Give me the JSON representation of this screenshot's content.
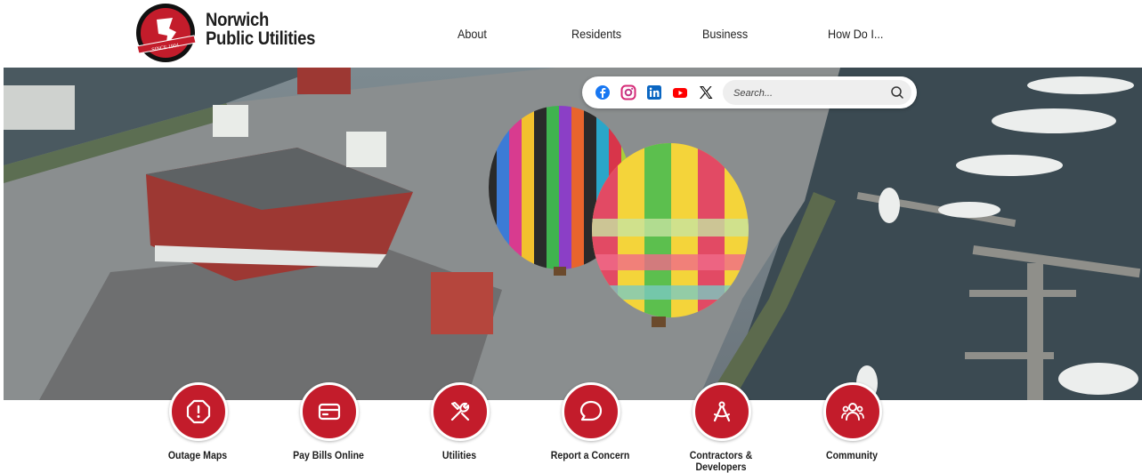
{
  "brand": {
    "line1": "Norwich",
    "line2": "Public Utilities",
    "logo_text": "NORWICH PUBLIC UTILITIES",
    "logo_since": "SINCE 1904"
  },
  "nav": {
    "items": [
      "About",
      "Residents",
      "Business",
      "How Do I..."
    ]
  },
  "social": {
    "icons": [
      "facebook-icon",
      "instagram-icon",
      "linkedin-icon",
      "youtube-icon",
      "x-icon"
    ]
  },
  "search": {
    "placeholder": "Search..."
  },
  "quick_links": [
    {
      "label": "Outage Maps",
      "icon": "alert-icon"
    },
    {
      "label": "Pay Bills Online",
      "icon": "credit-card-icon"
    },
    {
      "label": "Utilities",
      "icon": "tools-icon"
    },
    {
      "label": "Report a Concern",
      "icon": "chat-bubble-icon"
    },
    {
      "label": "Contractors & Developers",
      "icon": "compass-icon"
    },
    {
      "label": "Community",
      "icon": "people-icon"
    }
  ],
  "colors": {
    "brand_red": "#c31c2b",
    "text": "#1d1d1d"
  }
}
